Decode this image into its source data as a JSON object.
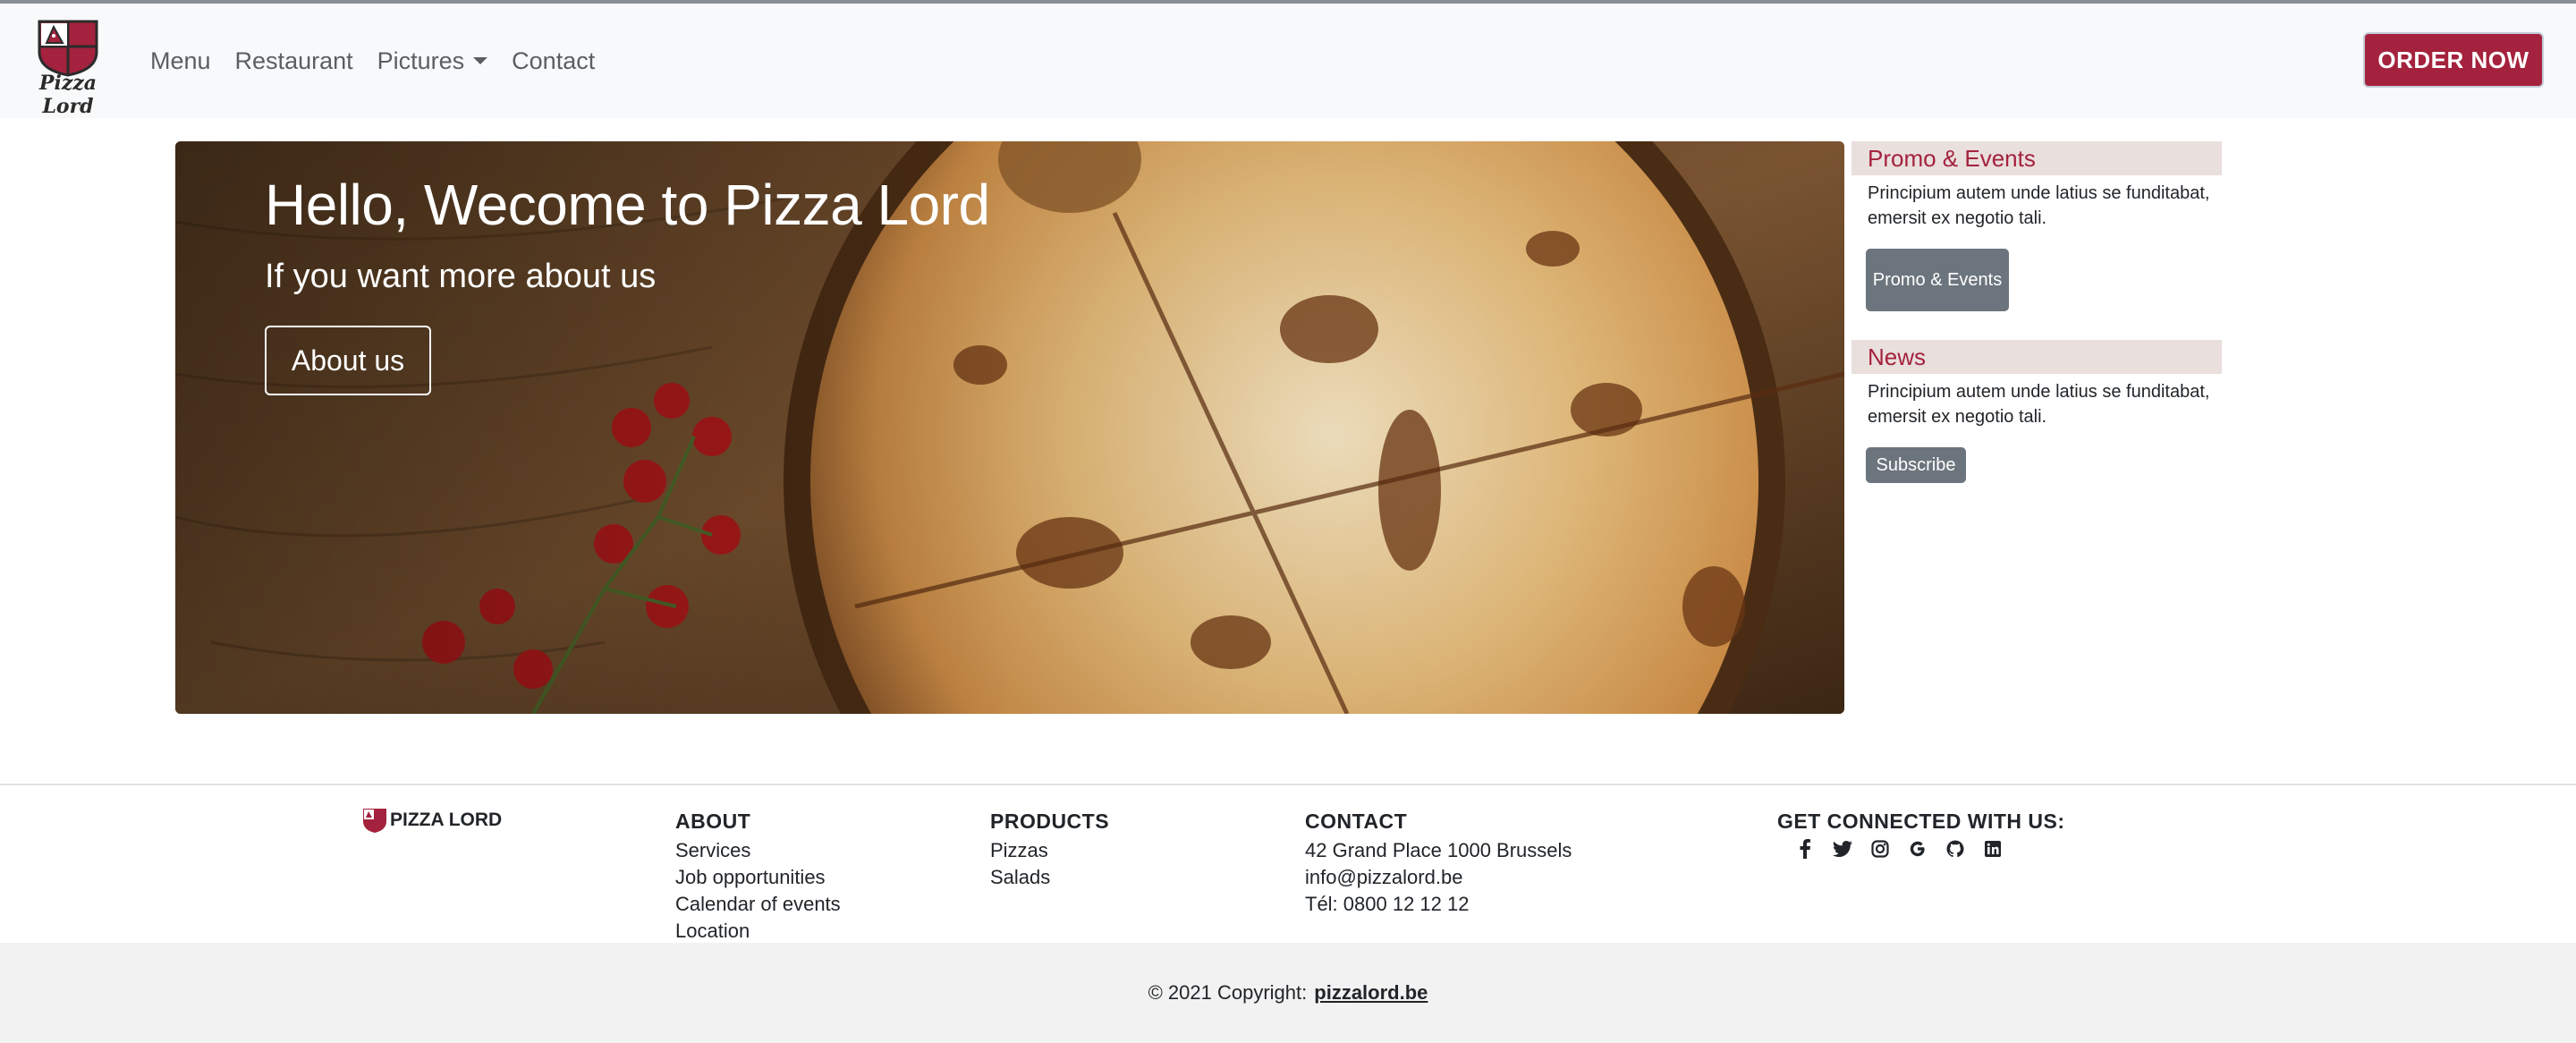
{
  "navbar": {
    "brand": "Pizza Lord",
    "links": [
      "Menu",
      "Restaurant",
      "Pictures",
      "Contact"
    ],
    "order_button": "ORDER NOW"
  },
  "hero": {
    "title": "Hello, Wecome to Pizza Lord",
    "subtitle": "If you want more about us",
    "button": "About us"
  },
  "sidebar": {
    "promo": {
      "title": "Promo & Events",
      "text": "Principium autem unde latius se funditabat, emersit ex negotio tali.",
      "button": "Promo & Events"
    },
    "news": {
      "title": "News",
      "text": "Principium autem unde latius se funditabat, emersit ex negotio tali.",
      "button": "Subscribe"
    }
  },
  "footer": {
    "brand": "PIZZA LORD",
    "about": {
      "title": "ABOUT",
      "items": [
        "Services",
        "Job opportunities",
        "Calendar of events",
        "Location"
      ]
    },
    "products": {
      "title": "PRODUCTS",
      "items": [
        "Pizzas",
        "Salads"
      ]
    },
    "contact": {
      "title": "CONTACT",
      "items": [
        "42 Grand Place 1000 Brussels",
        "info@pizzalord.be",
        "Tél: 0800 12 12 12"
      ]
    },
    "social": {
      "title": "GET CONNECTED WITH US:",
      "icons": [
        "facebook-icon",
        "twitter-icon",
        "instagram-icon",
        "google-icon",
        "github-icon",
        "linkedin-icon"
      ]
    },
    "copyright": "© 2021 Copyright:",
    "copyright_link": "pizzalord.be"
  },
  "colors": {
    "brand": "#a4223d",
    "navbar_bg": "#f8f9fa",
    "side_head_bg": "#e9dfdd",
    "secondary_button": "#6c757d",
    "footer_bottom_bg": "#f2f2f2"
  }
}
